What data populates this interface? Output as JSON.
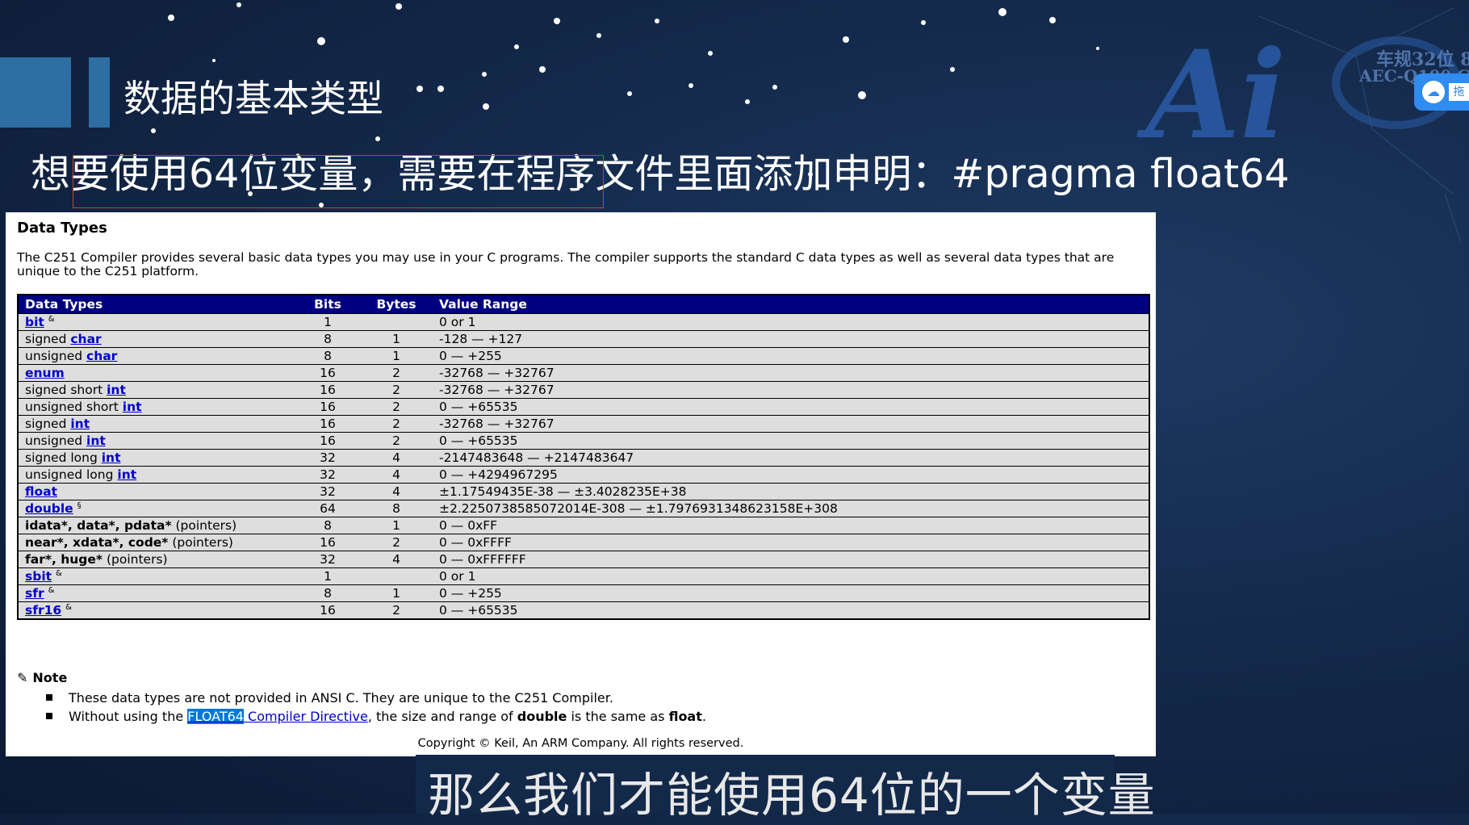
{
  "slide": {
    "title": "数据的基本类型",
    "subtitle": "想要使用64位变量，需要在程序文件里面添加申明：#pragma float64",
    "caption": "那么我们才能使用64位的一个变量",
    "logo_text": "Ai",
    "logo_line1": "车规32位 8",
    "logo_line2": "AEC-Q100 G",
    "cloud_button_label": "拖",
    "colors": {
      "background": "#142a4c",
      "accent_bar": "#2d6ea3",
      "table_header": "#000080",
      "link": "#0000cc"
    }
  },
  "doc": {
    "title": "Data Types",
    "intro": "The C251 Compiler provides several basic data types you may use in your C programs. The compiler supports the standard C data types as well as several data types that are unique to the C251 platform.",
    "columns": [
      "Data Types",
      "Bits",
      "Bytes",
      "Value Range"
    ],
    "rows": [
      {
        "prefix": "",
        "link": "bit",
        "suffix": "",
        "mark": "&",
        "bits": "1",
        "bytes": "",
        "range": "0 or 1"
      },
      {
        "prefix": "signed ",
        "link": "char",
        "suffix": "",
        "mark": "",
        "bits": "8",
        "bytes": "1",
        "range": "-128 — +127"
      },
      {
        "prefix": "unsigned ",
        "link": "char",
        "suffix": "",
        "mark": "",
        "bits": "8",
        "bytes": "1",
        "range": "0 — +255"
      },
      {
        "prefix": "",
        "link": "enum",
        "suffix": "",
        "mark": "",
        "bits": "16",
        "bytes": "2",
        "range": "-32768 — +32767"
      },
      {
        "prefix": "signed short ",
        "link": "int",
        "suffix": "",
        "mark": "",
        "bits": "16",
        "bytes": "2",
        "range": "-32768 — +32767"
      },
      {
        "prefix": "unsigned short ",
        "link": "int",
        "suffix": "",
        "mark": "",
        "bits": "16",
        "bytes": "2",
        "range": "0 — +65535"
      },
      {
        "prefix": "signed ",
        "link": "int",
        "suffix": "",
        "mark": "",
        "bits": "16",
        "bytes": "2",
        "range": "-32768 — +32767"
      },
      {
        "prefix": "unsigned ",
        "link": "int",
        "suffix": "",
        "mark": "",
        "bits": "16",
        "bytes": "2",
        "range": "0 — +65535"
      },
      {
        "prefix": "signed long ",
        "link": "int",
        "suffix": "",
        "mark": "",
        "bits": "32",
        "bytes": "4",
        "range": "-2147483648 — +2147483647"
      },
      {
        "prefix": "unsigned long ",
        "link": "int",
        "suffix": "",
        "mark": "",
        "bits": "32",
        "bytes": "4",
        "range": "0 — +4294967295"
      },
      {
        "prefix": "",
        "link": "float",
        "suffix": "",
        "mark": "",
        "bits": "32",
        "bytes": "4",
        "range": "±1.17549435E-38 — ±3.4028235E+38"
      },
      {
        "prefix": "",
        "link": "double",
        "suffix": "",
        "mark": "§",
        "bits": "64",
        "bytes": "8",
        "range": "±2.2250738585072014E-308 — ±1.7976931348623158E+308"
      },
      {
        "prefix": "",
        "link": "",
        "bold": "idata*, data*, pdata*",
        "suffix": " (pointers)",
        "mark": "",
        "bits": "8",
        "bytes": "1",
        "range": "0 — 0xFF"
      },
      {
        "prefix": "",
        "link": "",
        "bold": "near*, xdata*, code*",
        "suffix": " (pointers)",
        "mark": "",
        "bits": "16",
        "bytes": "2",
        "range": "0 — 0xFFFF"
      },
      {
        "prefix": "",
        "link": "",
        "bold": "far*, huge*",
        "suffix": " (pointers)",
        "mark": "",
        "bits": "32",
        "bytes": "4",
        "range": "0 — 0xFFFFFF"
      },
      {
        "prefix": "",
        "link": "sbit",
        "suffix": "",
        "mark": "&",
        "bits": "1",
        "bytes": "",
        "range": "0 or 1"
      },
      {
        "prefix": "",
        "link": "sfr",
        "suffix": "",
        "mark": "&",
        "bits": "8",
        "bytes": "1",
        "range": "0 — +255"
      },
      {
        "prefix": "",
        "link": "sfr16",
        "suffix": "",
        "mark": "&",
        "bits": "16",
        "bytes": "2",
        "range": "0 — +65535"
      }
    ],
    "note_title": "Note",
    "note1": "These data types are not provided in ANSI C. They are unique to the C251 Compiler.",
    "note2_pre": "Without using the ",
    "note2_hl": "FLOAT64",
    "note2_link": " Compiler Directive",
    "note2_mid": ", the size and range of ",
    "note2_b1": "double",
    "note2_mid2": " is the same as ",
    "note2_b2": "float",
    "note2_end": ".",
    "copyright": "Copyright © Keil, An ARM Company. All rights reserved."
  }
}
